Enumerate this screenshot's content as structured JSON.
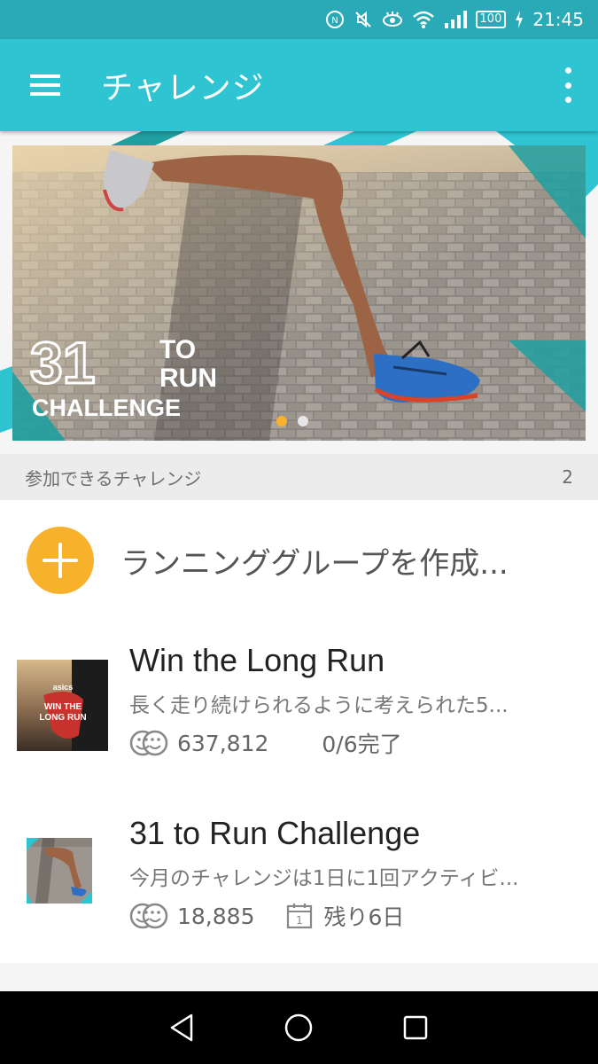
{
  "status_bar": {
    "time": "21:45",
    "battery": "100",
    "icons": [
      "nfc-icon",
      "mute-icon",
      "eye-comfort-icon",
      "wifi-icon",
      "signal-icon",
      "battery-icon",
      "charging-icon"
    ]
  },
  "app_bar": {
    "title": "チャレンジ",
    "menu_icon": "hamburger-menu-icon",
    "overflow_icon": "more-vert-icon"
  },
  "banner": {
    "title_big": "31",
    "title_to": "TO",
    "title_run": "RUN",
    "title_challenge": "CHALLENGE",
    "page_count": 2,
    "active_page": 1
  },
  "section": {
    "label": "参加できるチャレンジ",
    "count": "2"
  },
  "create_group": {
    "label": "ランニンググループを作成..."
  },
  "challenges": [
    {
      "title": "Win the Long Run",
      "description": "長く走り続けられるように考えられた5...",
      "participants": "637,812",
      "status": "0/6完了",
      "thumb_line1": "asics",
      "thumb_line2": "WIN THE",
      "thumb_line3": "LONG RUN"
    },
    {
      "title": "31 to Run Challenge",
      "description": "今月のチャレンジは1日に1回アクティビ...",
      "participants": "18,885",
      "remaining": "残り6日",
      "calendar_day": "1"
    }
  ],
  "colors": {
    "status_bar": "#2aa9b6",
    "app_bar": "#2ec4d2",
    "accent": "#f7b12b",
    "teal_stripe": "#1f9fa0"
  }
}
